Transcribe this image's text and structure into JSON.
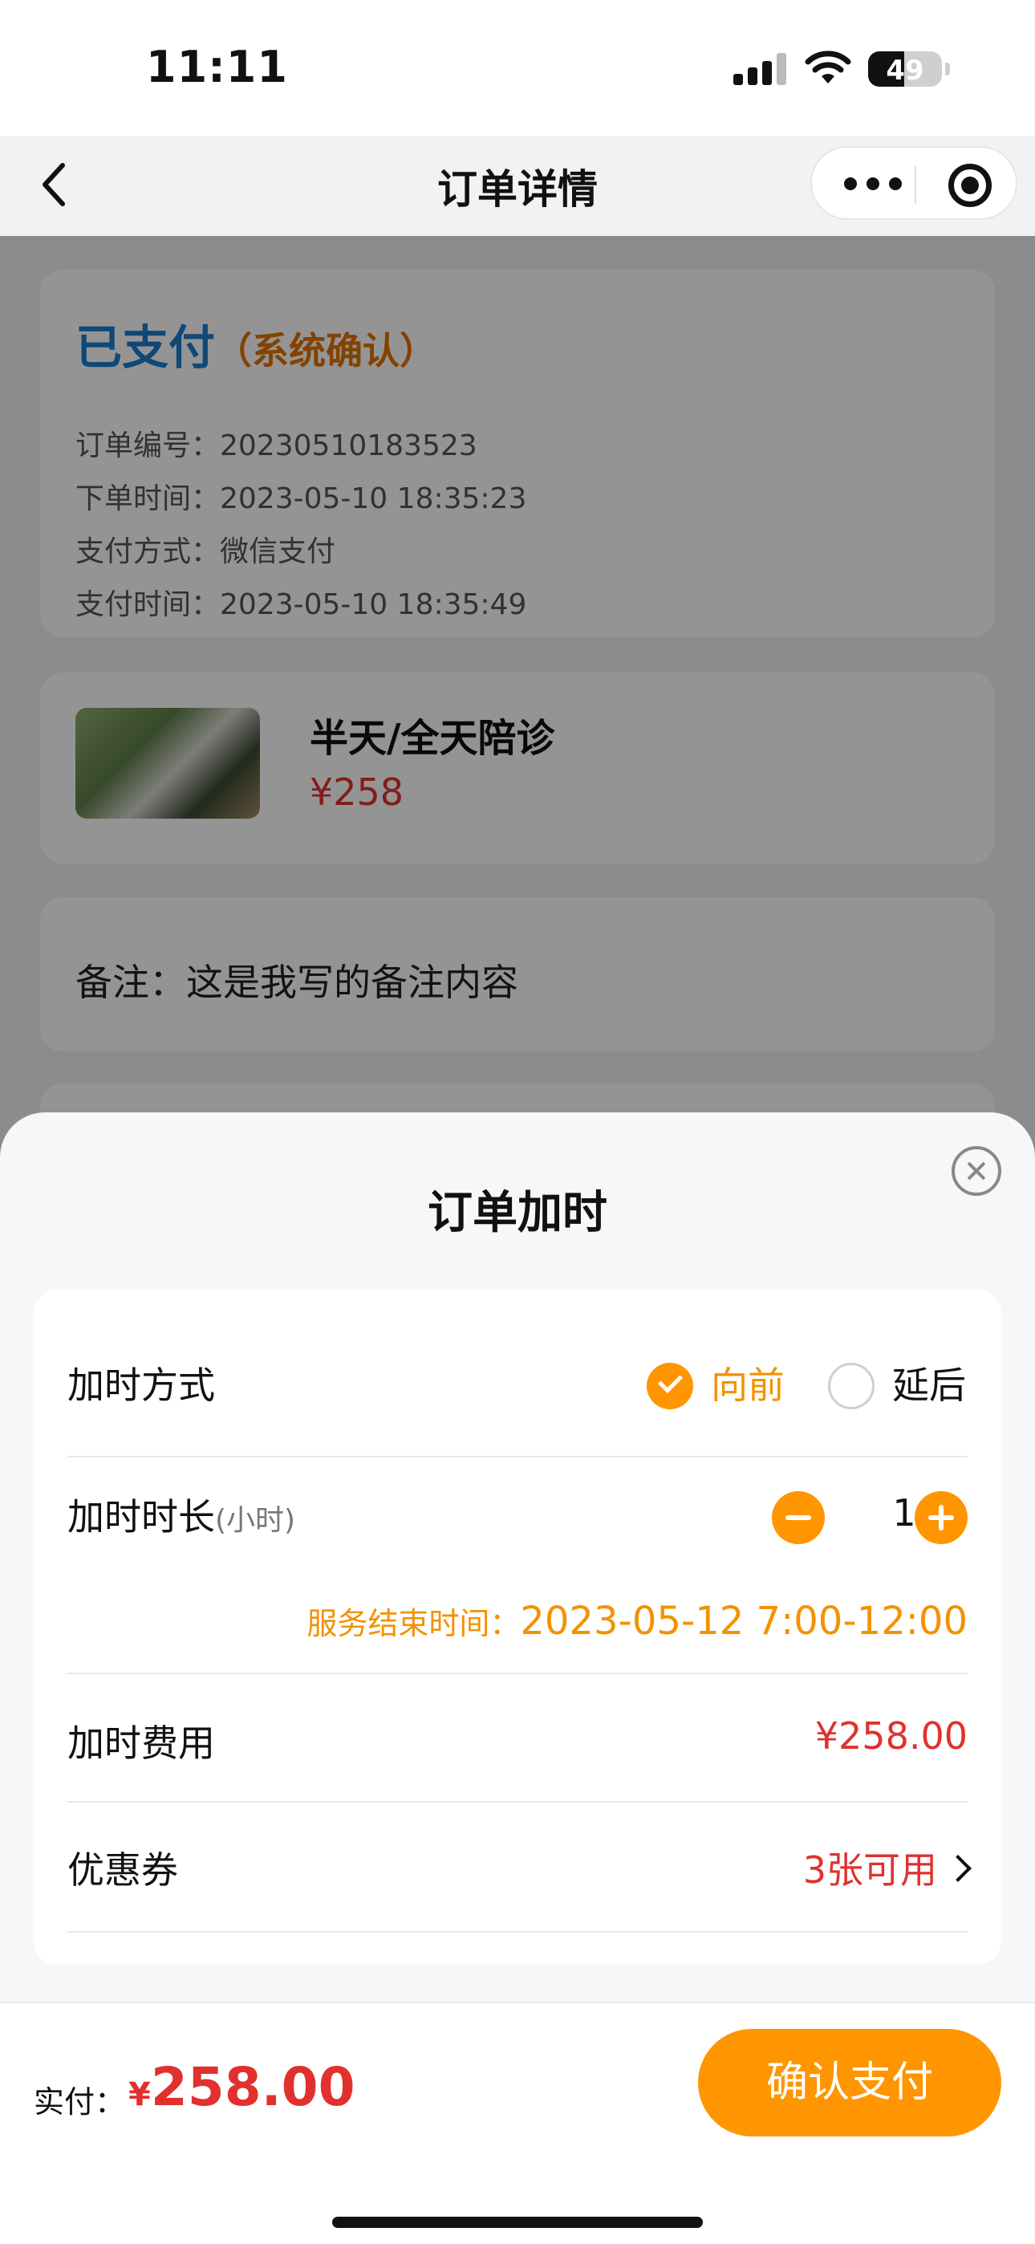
{
  "status_bar": {
    "time": "11:11",
    "battery": "49"
  },
  "nav": {
    "title": "订单详情"
  },
  "order": {
    "status": "已支付",
    "status_sub": "（系统确认）",
    "info": [
      "订单编号：20230510183523",
      "下单时间：2023-05-10 18:35:23",
      "支付方式：微信支付",
      "支付时间：2023-05-10 18:35:49"
    ]
  },
  "product": {
    "name": "半天/全天陪诊",
    "price": "¥258"
  },
  "remark": "备注：这是我写的备注内容",
  "sheet": {
    "title": "订单加时",
    "mode_label": "加时方式",
    "mode_options": [
      "向前",
      "延后"
    ],
    "mode_selected": "向前",
    "duration_label": "加时时长",
    "duration_unit": "(小时)",
    "duration_value": "1",
    "end_time_label": "服务结束时间：",
    "end_time_value": "2023-05-12 7:00-12:00",
    "fee_label": "加时费用",
    "fee_value": "¥258.00",
    "coupon_label": "优惠券",
    "coupon_value": "3张可用"
  },
  "footer": {
    "pay_label": "实付：",
    "currency": "¥",
    "amount": "258.00",
    "confirm_label": "确认支付"
  },
  "colors": {
    "accent": "#ff9500",
    "price": "#e0312f",
    "status": "#1a7ccc"
  }
}
